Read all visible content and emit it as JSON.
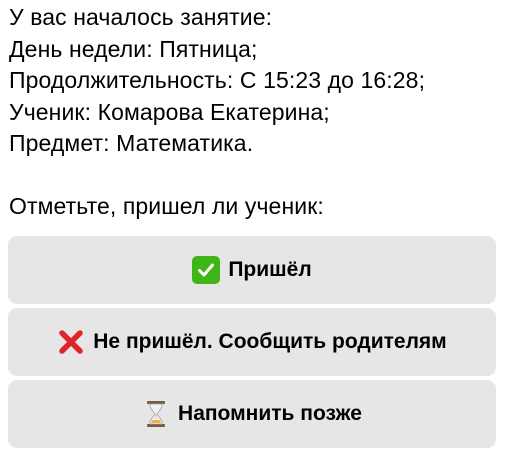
{
  "message": {
    "lines": [
      "У вас началось занятие:",
      "День недели: Пятница;",
      "Продолжительность: С 15:23 до 16:28;",
      "Ученик: Комарова Екатерина;",
      "Предмет: Математика."
    ],
    "prompt": "Отметьте, пришел ли ученик:"
  },
  "buttons": [
    {
      "icon": "check-mark-icon",
      "label": "Пришёл"
    },
    {
      "icon": "cross-mark-icon",
      "label": "Не пришёл. Сообщить родителям"
    },
    {
      "icon": "hourglass-icon",
      "label": "Напомнить позже"
    }
  ],
  "colors": {
    "button_background": "#e6e6e6",
    "check_green": "#3fb618",
    "cross_red": "#e0242b",
    "hourglass_frame": "#7a5a3a",
    "hourglass_sand": "#f2b33d"
  }
}
